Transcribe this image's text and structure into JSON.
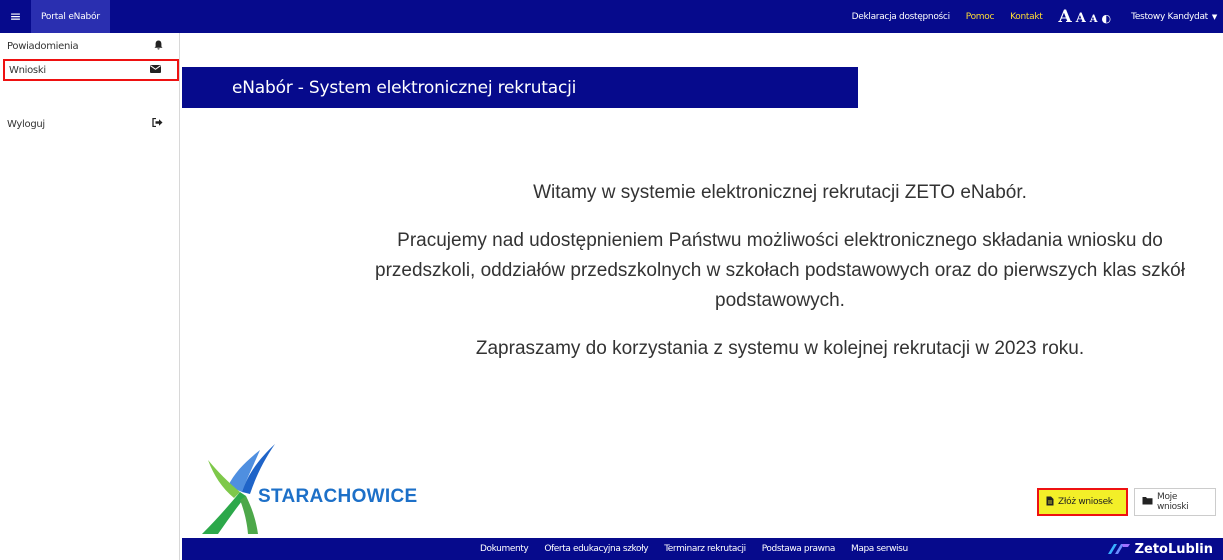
{
  "topbar": {
    "menu_icon": "hamburger-icon",
    "brand": "Portal eNabór",
    "links": {
      "accessibility": "Deklaracja dostępności",
      "help": "Pomoc",
      "contact": "Kontakt"
    },
    "font_controls": {
      "large": "A",
      "medium": "A",
      "small": "A",
      "contrast": "◐"
    },
    "user": "Testowy Kandydat",
    "colors": {
      "background": "#060a8c",
      "highlight": "#ffdd33"
    }
  },
  "sidebar": {
    "items": [
      {
        "label": "Powiadomienia",
        "icon": "bell-icon"
      },
      {
        "label": "Wnioski",
        "icon": "envelope-icon"
      },
      {
        "label": "Wyloguj",
        "icon": "logout-icon"
      }
    ]
  },
  "banner": {
    "title": "eNabór - System elektronicznej rekrutacji"
  },
  "welcome": {
    "line1": "Witamy w systemie elektronicznej rekrutacji ZETO eNabór.",
    "line2": "Pracujemy nad udostępnieniem Państwu możliwości elektronicznego składania wniosku do przedszkoli, oddziałów przedszkolnych w szkołach podstawowych oraz do pierwszych klas szkół podstawowych.",
    "line3": "Zapraszamy do korzystania z systemu w kolejnej rekrutacji w 2023 roku."
  },
  "logo": {
    "text": "STARACHOWICE"
  },
  "actions": {
    "submit": {
      "label": "Złóż wniosek",
      "icon": "document-icon"
    },
    "my_applications": {
      "label": "Moje wnioski",
      "icon": "folder-icon"
    }
  },
  "footer": {
    "links": [
      "Dokumenty",
      "Oferta edukacyjna szkoły",
      "Terminarz rekrutacji",
      "Podstawa prawna",
      "Mapa serwisu"
    ],
    "brand": "ZetoLublin"
  }
}
